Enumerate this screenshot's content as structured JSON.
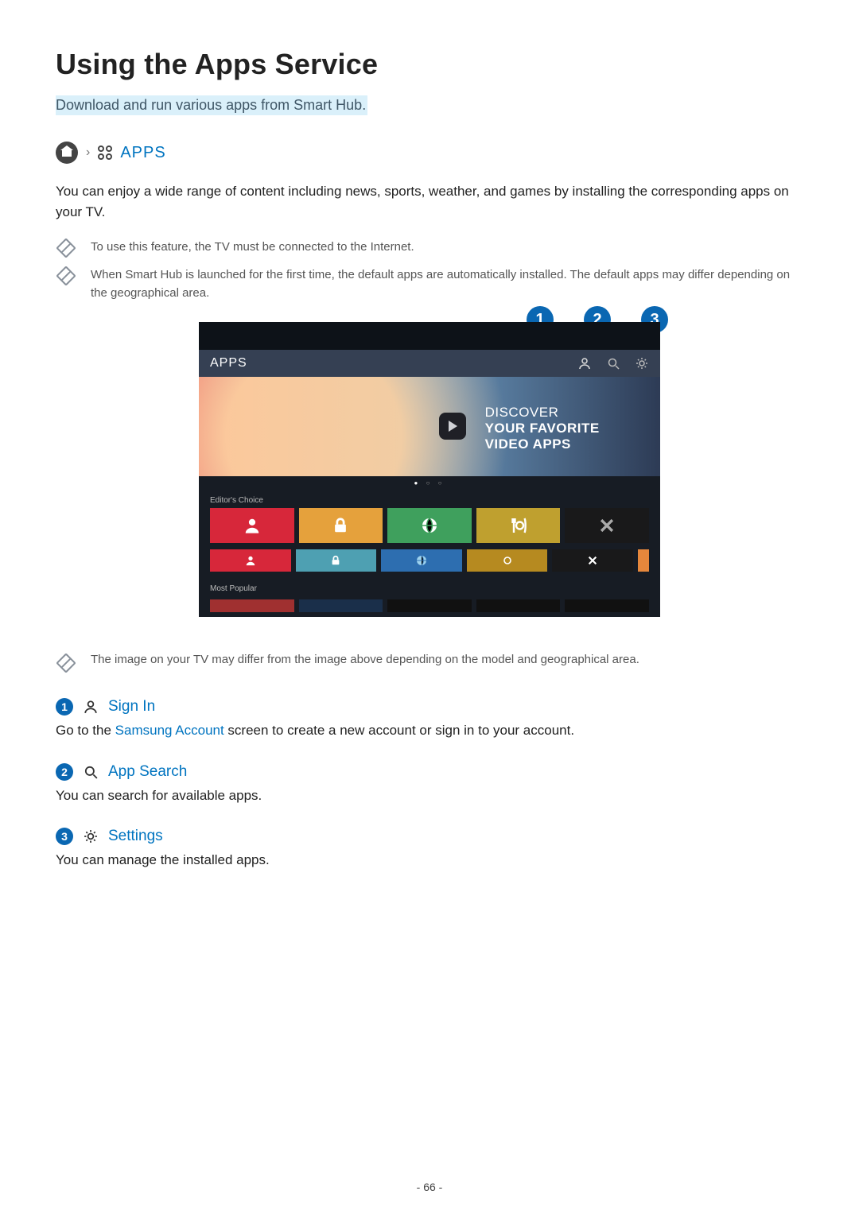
{
  "title": "Using the Apps Service",
  "subtitle": "Download and run various apps from Smart Hub.",
  "breadcrumb": {
    "apps": "APPS"
  },
  "intro": "You can enjoy a wide range of content including news, sports, weather, and games by installing the corresponding apps on your TV.",
  "notes": [
    "To use this feature, the TV must be connected to the Internet.",
    "When Smart Hub is launched for the first time, the default apps are automatically installed. The default apps may differ depending on the geographical area."
  ],
  "callouts": [
    "1",
    "2",
    "3"
  ],
  "screenshot": {
    "header_title": "APPS",
    "banner": {
      "line1": "DISCOVER",
      "line2": "YOUR FAVORITE",
      "line3": "VIDEO APPS"
    },
    "section1": "Editor's Choice",
    "section2": "Most Popular"
  },
  "image_note": "The image on your TV may differ from the image above depending on the model and geographical area.",
  "features": [
    {
      "num": "1",
      "icon": "person",
      "label": "Sign In",
      "desc_pre": "Go to the ",
      "desc_link": "Samsung Account",
      "desc_post": " screen to create a new account or sign in to your account."
    },
    {
      "num": "2",
      "icon": "search",
      "label": "App Search",
      "desc_pre": "You can search for available apps.",
      "desc_link": "",
      "desc_post": ""
    },
    {
      "num": "3",
      "icon": "gear",
      "label": "Settings",
      "desc_pre": "You can manage the installed apps.",
      "desc_link": "",
      "desc_post": ""
    }
  ],
  "page_number": "- 66 -"
}
